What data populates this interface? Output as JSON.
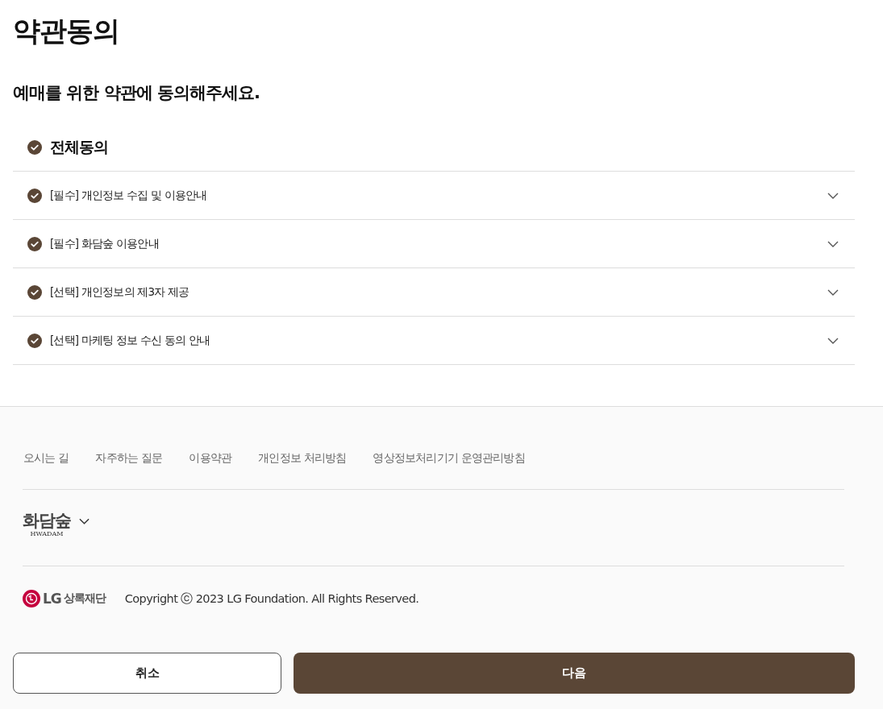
{
  "title": "약관동의",
  "subtitle": "예매를 위한 약관에 동의해주세요.",
  "agree_all": {
    "label": "전체동의",
    "checked": true
  },
  "terms": [
    {
      "label": "[필수] 개인정보 수집 및 이용안내",
      "checked": true,
      "expanded": false
    },
    {
      "label": "[필수] 화담숲 이용안내",
      "checked": true,
      "expanded": false
    },
    {
      "label": "[선택] 개인정보의 제3자 제공",
      "checked": true,
      "expanded": false
    },
    {
      "label": "[선택] 마케팅 정보 수신 동의 안내",
      "checked": true,
      "expanded": false
    }
  ],
  "footer": {
    "links": [
      "오시는 길",
      "자주하는 질문",
      "이용약관",
      "개인정보 처리방침",
      "영상정보처리기기 운영관리방침"
    ],
    "site_logo": {
      "name": "화담숲",
      "sub": "HWADAM"
    },
    "foundation_logo": {
      "brand": "LG",
      "name": "상록재단"
    },
    "copyright": "Copyright ⓒ 2023 LG Foundation. All Rights Reserved."
  },
  "buttons": {
    "cancel": "취소",
    "next": "다음"
  }
}
